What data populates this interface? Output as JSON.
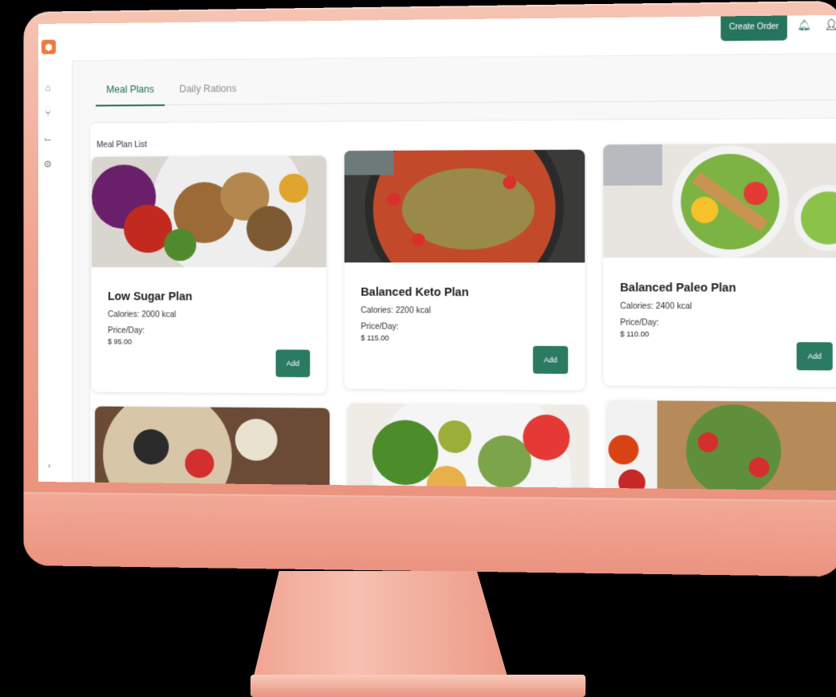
{
  "header": {
    "create_order": "Create Order",
    "bell_icon": "bell-icon",
    "user_icon": "user-icon"
  },
  "sidebar": {
    "logo": "logo",
    "items": [
      {
        "icon": "home-icon"
      },
      {
        "icon": "utensils-icon"
      },
      {
        "icon": "chart-icon"
      },
      {
        "icon": "settings-icon"
      }
    ],
    "collapse_icon": "collapse-icon"
  },
  "tabs": [
    {
      "label": "Meal Plans",
      "active": true
    },
    {
      "label": "Daily Rations",
      "active": false
    }
  ],
  "panel": {
    "title": "Meal Plan List"
  },
  "plans": [
    {
      "name": "Low Sugar Plan",
      "calories": "Calories: 2000 kcal",
      "price_label": "Price/Day:",
      "price": "$ 95.00",
      "add": "Add"
    },
    {
      "name": "Balanced Keto Plan",
      "calories": "Calories: 2200 kcal",
      "price_label": "Price/Day:",
      "price": "$ 115.00",
      "add": "Add"
    },
    {
      "name": "Balanced Paleo Plan",
      "calories": "Calories: 2400 kcal",
      "price_label": "Price/Day:",
      "price": "$ 110.00",
      "add": "Add"
    }
  ],
  "colors": {
    "primary": "#26745d",
    "frame": "#f0a38f"
  }
}
